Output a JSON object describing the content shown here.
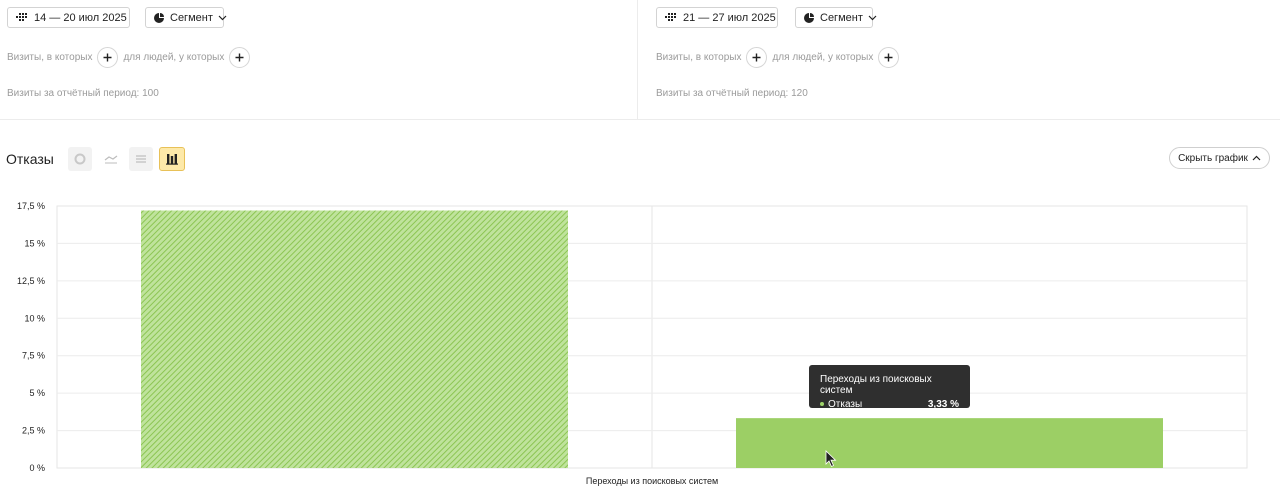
{
  "left_panel": {
    "date_range": "14 — 20 июл 2025",
    "segment_label": "Сегмент",
    "filter_visits_label": "Визиты, в которых",
    "filter_people_label": "для людей, у которых",
    "visits_text": "Визиты за отчётный период: 100"
  },
  "right_panel": {
    "date_range": "21 — 27 июл 2025",
    "segment_label": "Сегмент",
    "filter_visits_label": "Визиты, в которых",
    "filter_people_label": "для людей, у которых",
    "visits_text": "Визиты за отчётный период: 120"
  },
  "chart_header": {
    "title": "Отказы",
    "hide_button": "Скрыть график",
    "chart_type_icons": [
      "pie-chart-icon",
      "line-chart-icon",
      "area-chart-icon",
      "bar-chart-icon"
    ],
    "active_chart_type": "bar-chart-icon"
  },
  "chart_data": {
    "type": "bar",
    "categories": [
      "Переходы из поисковых систем"
    ],
    "series": [
      {
        "values": [
          17.2
        ],
        "color": "#9ccf65",
        "pattern": "hatched"
      },
      {
        "values": [
          3.33
        ],
        "color": "#9ccf65",
        "pattern": "solid"
      }
    ],
    "ylim": [
      0,
      17.5
    ],
    "yticks": [
      "0 %",
      "2,5 %",
      "5 %",
      "7,5 %",
      "10 %",
      "12,5 %",
      "15 %",
      "17,5 %"
    ],
    "grid": true
  },
  "tooltip": {
    "title": "Переходы из поисковых систем",
    "metric": "Отказы",
    "value": "3,33 %"
  },
  "colors": {
    "bar_green": "#9ccf65",
    "tooltip_bg": "#2f2f2f",
    "active_button_bg": "#fde9a9"
  }
}
